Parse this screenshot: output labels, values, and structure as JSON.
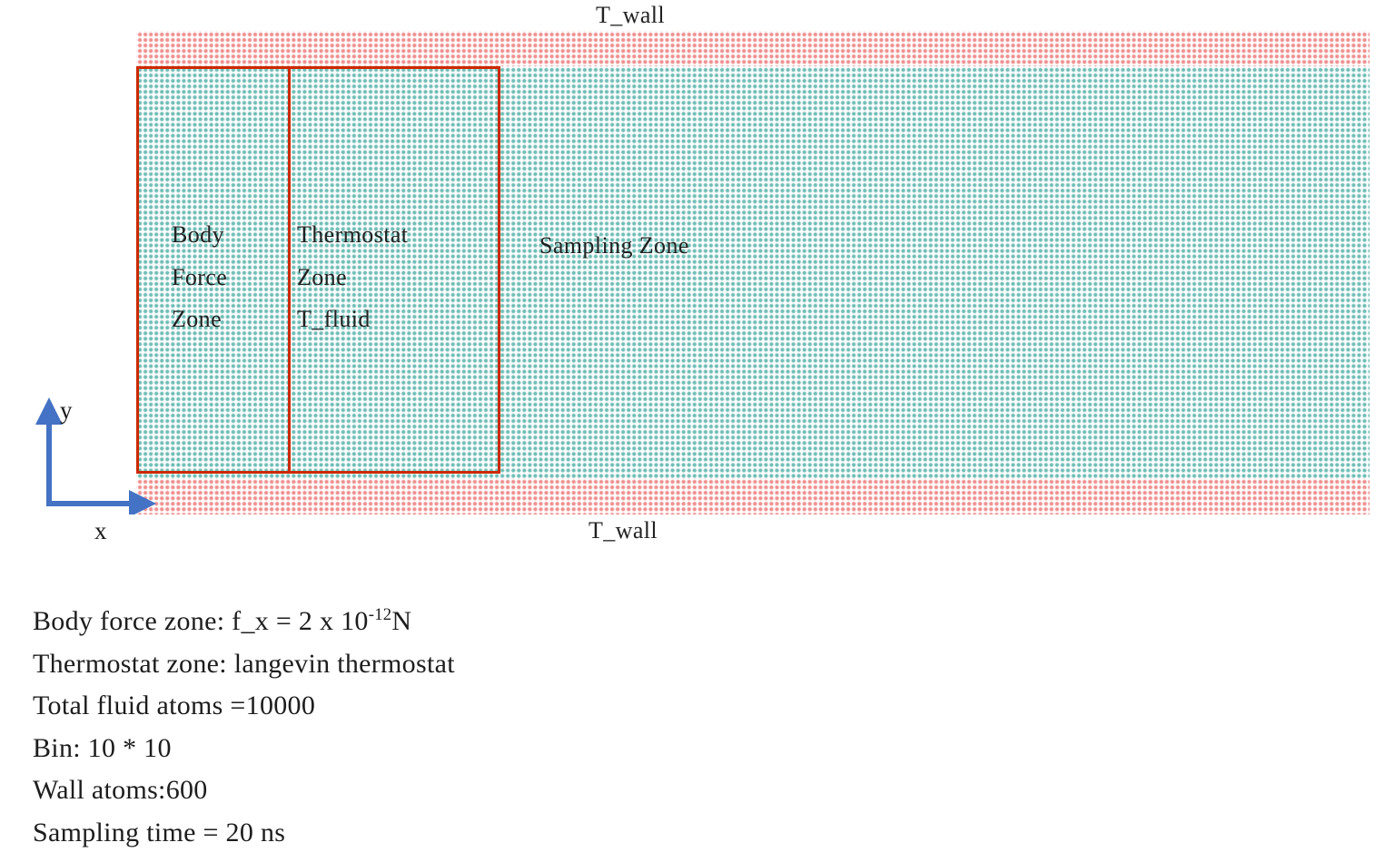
{
  "figure": {
    "domain": {
      "top_wall_label": "T_wall",
      "bottom_wall_label": "T_wall"
    },
    "zones": [
      {
        "id": "body-force-zone",
        "label": "Body\nForce\nZone"
      },
      {
        "id": "thermostat-zone",
        "label": "Thermostat\nZone\nT_fluid"
      },
      {
        "id": "sampling-zone",
        "label": "Sampling Zone"
      }
    ],
    "axes": {
      "x_label": "x",
      "y_label": "y"
    },
    "colors": {
      "wall_atom": "#ef8f8f",
      "fluid_atom": "#6fbdb6",
      "zone_outline": "#cc2900",
      "axis": "#4472c4"
    }
  },
  "caption": {
    "lines": [
      {
        "id": "body-force",
        "pre": "Body force zone: f_x = 2 x 10",
        "sup": "-12",
        "post": "N"
      },
      {
        "id": "thermostat",
        "pre": "Thermostat zone: langevin thermostat",
        "sup": "",
        "post": ""
      },
      {
        "id": "total-atoms",
        "pre": "Total fluid atoms =10000",
        "sup": "",
        "post": ""
      },
      {
        "id": "bin",
        "pre": "Bin: 10 * 10",
        "sup": "",
        "post": ""
      },
      {
        "id": "wall-atoms",
        "pre": "Wall atoms:600",
        "sup": "",
        "post": ""
      },
      {
        "id": "sampling-time",
        "pre": "Sampling time = 20 ns",
        "sup": "",
        "post": ""
      }
    ]
  }
}
